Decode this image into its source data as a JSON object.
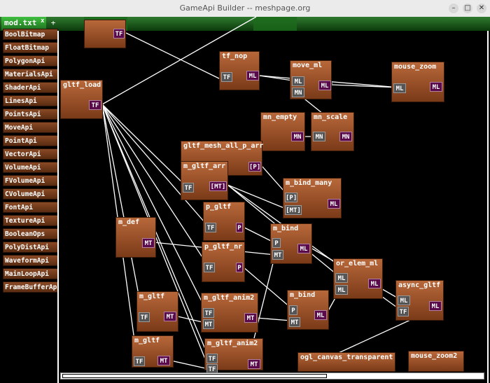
{
  "window": {
    "title": "GameApi Builder -- meshpage.org",
    "minimize": "–",
    "maximize": "□",
    "close": "✕"
  },
  "tab": {
    "label": "mod.txt",
    "close": "x",
    "add": "+"
  },
  "sidebar": {
    "items": [
      "BoolBitmap",
      "FloatBitmap",
      "PolygonApi",
      "MaterialsApi",
      "ShaderApi",
      "LinesApi",
      "PointsApi",
      "MoveApi",
      "PointApi",
      "VectorApi",
      "VolumeApi",
      "FVolumeApi",
      "CVolumeApi",
      "FontApi",
      "TextureApi",
      "BooleanOps",
      "PolyDistApi",
      "WaveformApi",
      "MainLoopApi",
      "FrameBufferApi"
    ]
  },
  "nodes": [
    {
      "id": "n_top",
      "title": "",
      "ports": [
        {
          "t": "TF",
          "k": "out"
        }
      ]
    },
    {
      "id": "gltf_load",
      "title": "gltf_load",
      "ports": [
        {
          "t": "TF",
          "k": "out"
        }
      ]
    },
    {
      "id": "tf_nop",
      "title": "tf_nop",
      "ports": [
        {
          "t": "TF",
          "k": "in"
        },
        {
          "t": "ML",
          "k": "out"
        }
      ]
    },
    {
      "id": "move_ml",
      "title": "move_ml",
      "ports": [
        {
          "t": "ML",
          "k": "in"
        },
        {
          "t": "MN",
          "k": "in"
        },
        {
          "t": "ML",
          "k": "out"
        }
      ]
    },
    {
      "id": "mouse_zoom",
      "title": "mouse_zoom",
      "ports": [
        {
          "t": "ML",
          "k": "in"
        },
        {
          "t": "ML",
          "k": "out"
        }
      ]
    },
    {
      "id": "mn_empty",
      "title": "mn_empty",
      "ports": [
        {
          "t": "MN",
          "k": "out"
        }
      ]
    },
    {
      "id": "mn_scale",
      "title": "mn_scale",
      "ports": [
        {
          "t": "MN",
          "k": "in"
        },
        {
          "t": "MN",
          "k": "out"
        }
      ]
    },
    {
      "id": "gltf_mesh_all_p_arr",
      "title": "gltf_mesh_all_p_arr",
      "ports": [
        {
          "t": "[P]",
          "k": "out"
        }
      ]
    },
    {
      "id": "m_gltf_arr",
      "title": "m_gltf_arr",
      "ports": [
        {
          "t": "TF",
          "k": "in"
        },
        {
          "t": "[MT]",
          "k": "out"
        }
      ]
    },
    {
      "id": "m_bind_many",
      "title": "m_bind_many",
      "ports": [
        {
          "t": "[P]",
          "k": "in"
        },
        {
          "t": "[MT]",
          "k": "in"
        },
        {
          "t": "ML",
          "k": "out"
        }
      ]
    },
    {
      "id": "p_gltf",
      "title": "p_gltf",
      "ports": [
        {
          "t": "TF",
          "k": "in"
        },
        {
          "t": "P",
          "k": "out"
        }
      ]
    },
    {
      "id": "m_def",
      "title": "m_def",
      "ports": [
        {
          "t": "MT",
          "k": "out"
        }
      ]
    },
    {
      "id": "m_bind1",
      "title": "m_bind",
      "ports": [
        {
          "t": "P",
          "k": "in"
        },
        {
          "t": "MT",
          "k": "in"
        },
        {
          "t": "ML",
          "k": "out"
        }
      ]
    },
    {
      "id": "p_gltf_nr",
      "title": "p_gltf_nr",
      "ports": [
        {
          "t": "TF",
          "k": "in"
        },
        {
          "t": "P",
          "k": "out"
        }
      ]
    },
    {
      "id": "or_elem_ml",
      "title": "or_elem_ml",
      "ports": [
        {
          "t": "ML",
          "k": "in"
        },
        {
          "t": "ML",
          "k": "in"
        },
        {
          "t": "ML",
          "k": "out"
        }
      ]
    },
    {
      "id": "async_gltf",
      "title": "async_gltf",
      "ports": [
        {
          "t": "ML",
          "k": "in"
        },
        {
          "t": "TF",
          "k": "in"
        },
        {
          "t": "ML",
          "k": "out"
        }
      ]
    },
    {
      "id": "m_gltf1",
      "title": "m_gltf",
      "ports": [
        {
          "t": "TF",
          "k": "in"
        },
        {
          "t": "MT",
          "k": "out"
        }
      ]
    },
    {
      "id": "m_gltf_anim2a",
      "title": "m_gltf_anim2",
      "ports": [
        {
          "t": "TF",
          "k": "in"
        },
        {
          "t": "MT",
          "k": "in"
        },
        {
          "t": "MT",
          "k": "out"
        }
      ]
    },
    {
      "id": "m_bind2",
      "title": "m_bind",
      "ports": [
        {
          "t": "P",
          "k": "in"
        },
        {
          "t": "MT",
          "k": "in"
        },
        {
          "t": "ML",
          "k": "out"
        }
      ]
    },
    {
      "id": "m_gltf2",
      "title": "m_gltf",
      "ports": [
        {
          "t": "TF",
          "k": "in"
        },
        {
          "t": "MT",
          "k": "out"
        }
      ]
    },
    {
      "id": "m_gltf_anim2b",
      "title": "m_gltf_anim2",
      "ports": [
        {
          "t": "TF",
          "k": "in"
        },
        {
          "t": "TF",
          "k": "in"
        },
        {
          "t": "MT",
          "k": "out"
        }
      ]
    },
    {
      "id": "ogl_canvas_transparent",
      "title": "ogl_canvas_transparent",
      "ports": []
    },
    {
      "id": "mouse_zoom2",
      "title": "mouse_zoom2",
      "ports": []
    }
  ]
}
